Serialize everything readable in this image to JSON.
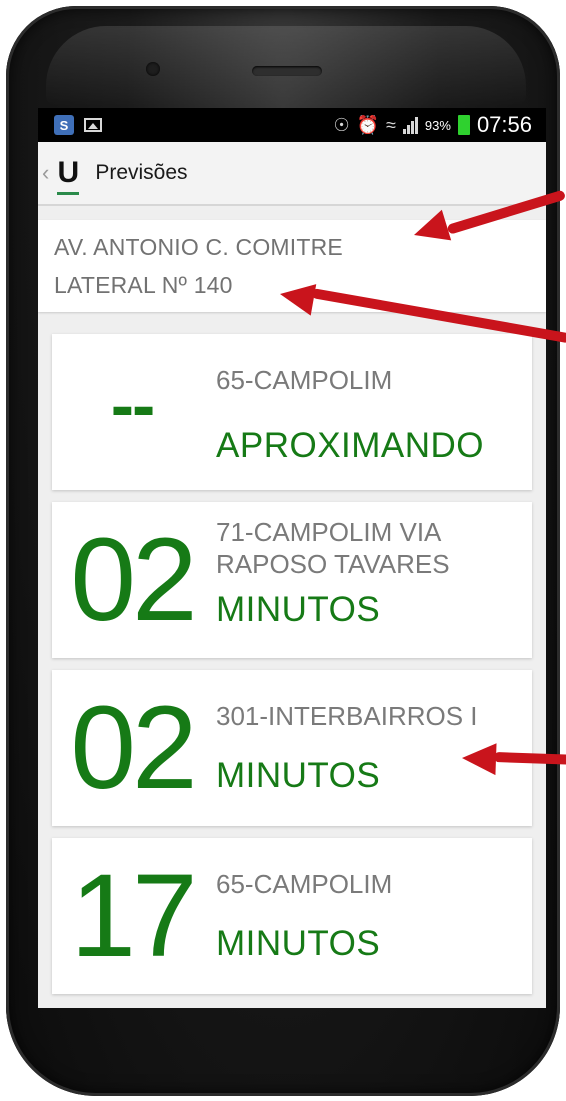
{
  "status_bar": {
    "app_icon_label": "S",
    "battery_percent": "93%",
    "time": "07:56",
    "icons": [
      "app-notification-icon",
      "gallery-icon",
      "eye-icon",
      "alarm-icon",
      "wifi-icon",
      "signal-icon",
      "battery-icon"
    ]
  },
  "action_bar": {
    "back_glyph": "‹",
    "logo_letter": "U",
    "title": "Previsões"
  },
  "stop": {
    "line1": "AV. ANTONIO C. COMITRE",
    "line2": "LATERAL Nº 140"
  },
  "predictions": [
    {
      "minutes": "--",
      "route": "65-CAMPOLIM",
      "status": "APROXIMANDO"
    },
    {
      "minutes": "02",
      "route": "71-CAMPOLIM VIA RAPOSO TAVARES",
      "status": "MINUTOS"
    },
    {
      "minutes": "02",
      "route": "301-INTERBAIRROS I",
      "status": "MINUTOS"
    },
    {
      "minutes": "17",
      "route": "65-CAMPOLIM",
      "status": "MINUTOS"
    }
  ],
  "colors": {
    "accent_green": "#167a16",
    "annotation_red": "#c9141c",
    "battery_green": "#2fd12f",
    "logo_underline": "#2a8a4a"
  }
}
